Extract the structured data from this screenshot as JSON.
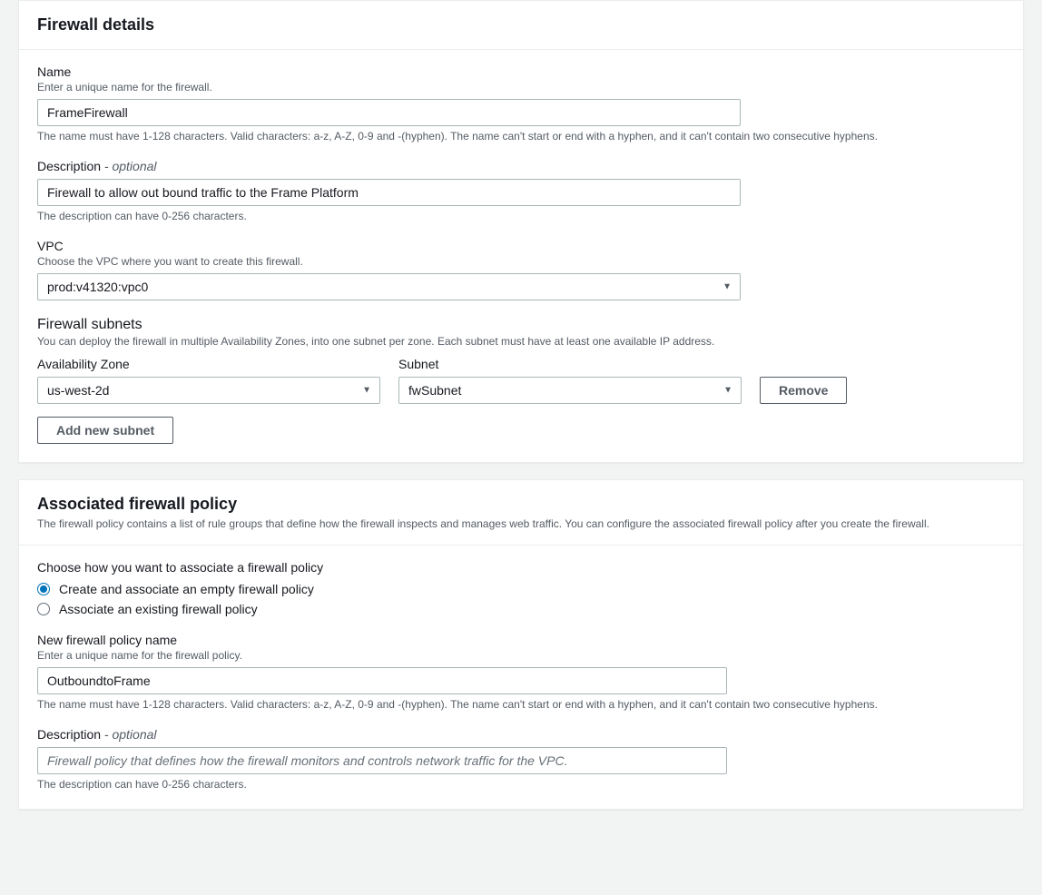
{
  "details": {
    "title": "Firewall details",
    "name": {
      "label": "Name",
      "sub": "Enter a unique name for the firewall.",
      "value": "FrameFirewall",
      "hint": "The name must have 1-128 characters. Valid characters: a-z, A-Z, 0-9 and -(hyphen). The name can't start or end with a hyphen, and it can't contain two consecutive hyphens."
    },
    "description": {
      "label": "Description",
      "optional": " - optional",
      "value": "Firewall to allow out bound traffic to the Frame Platform",
      "hint": "The description can have 0-256 characters."
    },
    "vpc": {
      "label": "VPC",
      "sub": "Choose the VPC where you want to create this firewall.",
      "value": "prod:v41320:vpc0"
    },
    "subnets": {
      "title": "Firewall subnets",
      "sub": "You can deploy the firewall in multiple Availability Zones, into one subnet per zone. Each subnet must have at least one available IP address.",
      "az_label": "Availability Zone",
      "az_value": "us-west-2d",
      "subnet_label": "Subnet",
      "subnet_value": "fwSubnet",
      "remove_label": "Remove",
      "add_label": "Add new subnet"
    }
  },
  "policy": {
    "title": "Associated firewall policy",
    "desc": "The firewall policy contains a list of rule groups that define how the firewall inspects and manages web traffic. You can configure the associated firewall policy after you create the firewall.",
    "choose_label": "Choose how you want to associate a firewall policy",
    "options": {
      "create": "Create and associate an empty firewall policy",
      "existing": "Associate an existing firewall policy"
    },
    "new_name": {
      "label": "New firewall policy name",
      "sub": "Enter a unique name for the firewall policy.",
      "value": "OutboundtoFrame",
      "hint": "The name must have 1-128 characters. Valid characters: a-z, A-Z, 0-9 and -(hyphen). The name can't start or end with a hyphen, and it can't contain two consecutive hyphens."
    },
    "description": {
      "label": "Description",
      "optional": " - optional",
      "placeholder": "Firewall policy that defines how the firewall monitors and controls network traffic for the VPC.",
      "hint": "The description can have 0-256 characters."
    }
  }
}
